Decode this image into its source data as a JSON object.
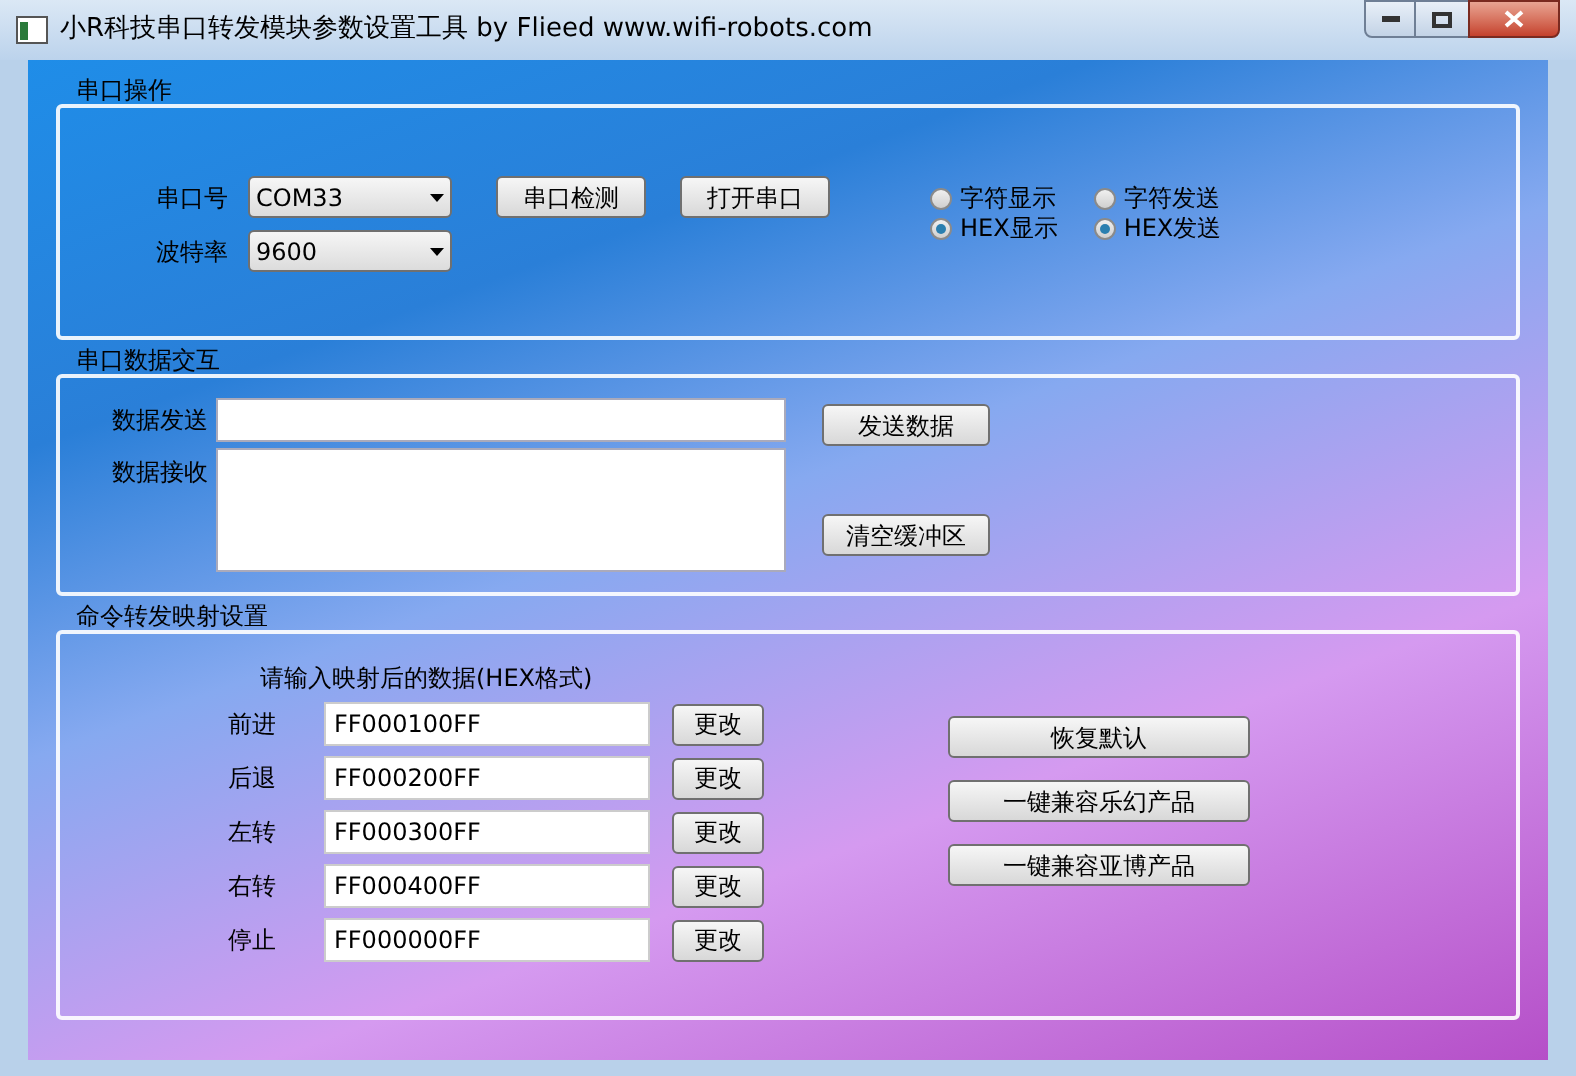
{
  "window": {
    "title": "小R科技串口转发模块参数设置工具 by Flieed  www.wifi-robots.com"
  },
  "serial": {
    "title": "串口操作",
    "port_label": "串口号",
    "port_value": "COM33",
    "baud_label": "波特率",
    "baud_value": "9600",
    "buttons": [
      "串口检测",
      "打开串口"
    ],
    "display_mode": [
      {
        "label": "字符显示",
        "selected": false
      },
      {
        "label": "HEX显示",
        "selected": true
      }
    ],
    "send_mode": [
      {
        "label": "字符发送",
        "selected": false
      },
      {
        "label": "HEX发送",
        "selected": true
      }
    ]
  },
  "exchange": {
    "title": "串口数据交互",
    "send_label": "数据发送",
    "receive_label": "数据接收",
    "send_button": "发送数据",
    "clear_button": "清空缓冲区"
  },
  "mapping": {
    "title": "命令转发映射设置",
    "hint": "请输入映射后的数据(HEX格式)",
    "rows": [
      {
        "label": "前进",
        "value": "FF000100FF",
        "button": "更改"
      },
      {
        "label": "后退",
        "value": "FF000200FF",
        "button": "更改"
      },
      {
        "label": "左转",
        "value": "FF000300FF",
        "button": "更改"
      },
      {
        "label": "右转",
        "value": "FF000400FF",
        "button": "更改"
      },
      {
        "label": "停止",
        "value": "FF000000FF",
        "button": "更改"
      }
    ],
    "buttons": [
      "恢复默认",
      "一键兼容乐幻产品",
      "一键兼容亚博产品"
    ]
  }
}
